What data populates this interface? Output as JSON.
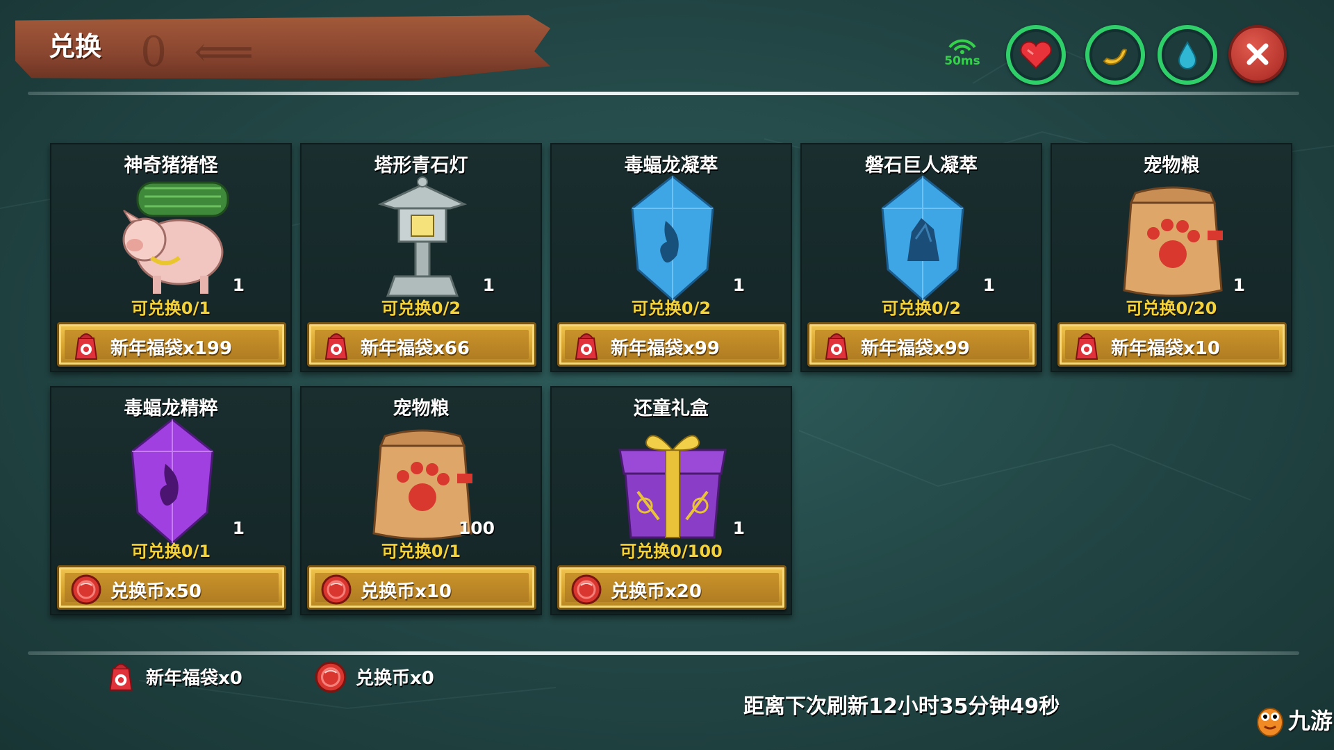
{
  "header": {
    "title": "兑换",
    "ping": "50ms"
  },
  "status_icons": [
    "heart-icon",
    "banana-icon",
    "water-drop-icon"
  ],
  "items": [
    {
      "name": "神奇猪猪怪",
      "art": "pig-icon",
      "qty": "1",
      "limit": "可兑换0/1",
      "cost_icon": "lucky-bag-icon",
      "cost": "新年福袋x199"
    },
    {
      "name": "塔形青石灯",
      "art": "stone-lantern-icon",
      "qty": "1",
      "limit": "可兑换0/2",
      "cost_icon": "lucky-bag-icon",
      "cost": "新年福袋x66"
    },
    {
      "name": "毒蝠龙凝萃",
      "art": "blue-crystal-icon",
      "qty": "1",
      "limit": "可兑换0/2",
      "cost_icon": "lucky-bag-icon",
      "cost": "新年福袋x99"
    },
    {
      "name": "磐石巨人凝萃",
      "art": "blue-crystal-rock-icon",
      "qty": "1",
      "limit": "可兑换0/2",
      "cost_icon": "lucky-bag-icon",
      "cost": "新年福袋x99"
    },
    {
      "name": "宠物粮",
      "art": "pet-food-bag-icon",
      "qty": "1",
      "limit": "可兑换0/20",
      "cost_icon": "lucky-bag-icon",
      "cost": "新年福袋x10"
    },
    {
      "name": "毒蝠龙精粹",
      "art": "purple-crystal-icon",
      "qty": "1",
      "limit": "可兑换0/1",
      "cost_icon": "exchange-coin-icon",
      "cost": "兑换币x50"
    },
    {
      "name": "宠物粮",
      "art": "pet-food-bag-icon",
      "qty": "100",
      "limit": "可兑换0/1",
      "cost_icon": "exchange-coin-icon",
      "cost": "兑换币x10"
    },
    {
      "name": "还童礼盒",
      "art": "gift-box-icon",
      "qty": "1",
      "limit": "可兑换0/100",
      "cost_icon": "exchange-coin-icon",
      "cost": "兑换币x20"
    }
  ],
  "currencies": [
    {
      "icon": "lucky-bag-icon",
      "label": "新年福袋x0"
    },
    {
      "icon": "exchange-coin-icon",
      "label": "兑换币x0"
    }
  ],
  "refresh_text": "距离下次刷新12小时35分钟49秒",
  "watermark": "九游",
  "colors": {
    "background": "#244948",
    "limit_text": "#f4d33a",
    "button_gold": "#d9a531",
    "ring_green": "#2fd06a",
    "close_red": "#b8362e"
  }
}
